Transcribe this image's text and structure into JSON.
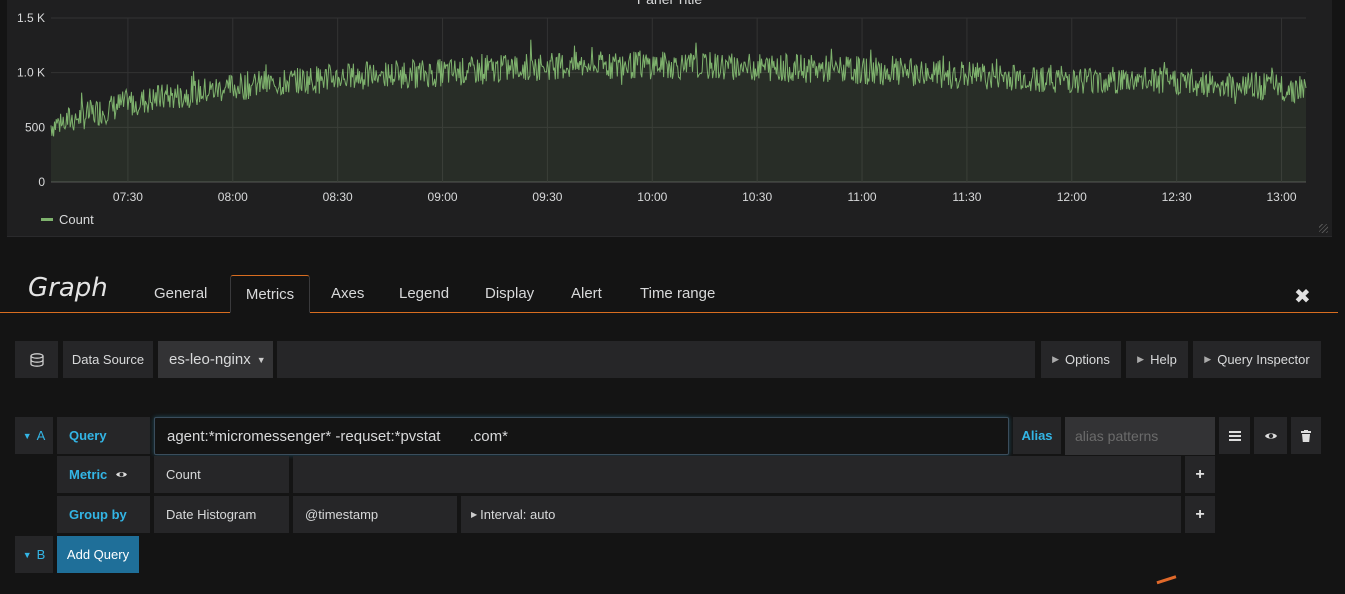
{
  "panel": {
    "title": "Panel Title",
    "legend_label": "Count"
  },
  "chart_data": {
    "type": "area",
    "series": [
      {
        "name": "Count",
        "color": "#7eb26d",
        "x": [
          "07:08",
          "07:30",
          "08:00",
          "08:30",
          "09:00",
          "09:30",
          "10:00",
          "10:30",
          "11:00",
          "11:30",
          "12:00",
          "12:30",
          "13:07"
        ],
        "values": [
          520,
          720,
          870,
          960,
          1000,
          1060,
          1070,
          1050,
          1020,
          980,
          940,
          920,
          850
        ]
      }
    ],
    "x_ticks": [
      "07:30",
      "08:00",
      "08:30",
      "09:00",
      "09:30",
      "10:00",
      "10:30",
      "11:00",
      "11:30",
      "12:00",
      "12:30",
      "13:00"
    ],
    "y_ticks": [
      "0",
      "500",
      "1.0 K",
      "1.5 K"
    ],
    "ylim": [
      0,
      1500
    ],
    "grid": true,
    "legend": "bottom-left"
  },
  "editor": {
    "title": "Graph",
    "tabs": [
      "General",
      "Metrics",
      "Axes",
      "Legend",
      "Display",
      "Alert",
      "Time range"
    ],
    "active_tab": "Metrics"
  },
  "datasource": {
    "label": "Data Source",
    "value": "es-leo-nginx",
    "options_btn": "Options",
    "help_btn": "Help",
    "inspector_btn": "Query Inspector"
  },
  "query_a": {
    "ref": "A",
    "query_label": "Query",
    "query_value": "agent:*micromessenger* -requset:*pvstat       .com*",
    "alias_label": "Alias",
    "alias_placeholder": "alias patterns",
    "metric_label": "Metric",
    "metric_value": "Count",
    "groupby_label": "Group by",
    "groupby_type": "Date Histogram",
    "groupby_field": "@timestamp",
    "groupby_interval": "Interval: auto"
  },
  "query_b": {
    "ref": "B",
    "add_label": "Add Query"
  }
}
